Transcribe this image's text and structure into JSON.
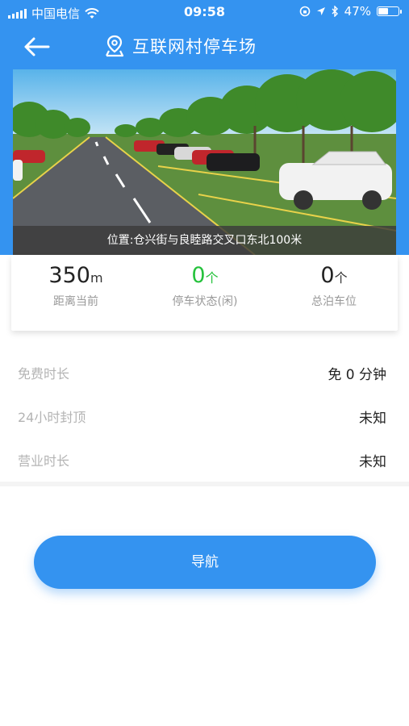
{
  "status_bar": {
    "carrier": "中国电信",
    "time": "09:58",
    "battery": "47%",
    "battery_level": 0.47
  },
  "header": {
    "title": "互联网村停车场"
  },
  "hero": {
    "location_caption": "位置:仓兴街与良睦路交叉口东北100米"
  },
  "stats": [
    {
      "value": "350",
      "unit": "m",
      "label": "距离当前"
    },
    {
      "value": "0",
      "unit": "个",
      "label": "停车状态(闲)"
    },
    {
      "value": "0",
      "unit": "个",
      "label": "总泊车位"
    }
  ],
  "info": [
    {
      "key": "免费时长",
      "value": "免 0 分钟"
    },
    {
      "key": "24小时封顶",
      "value": "未知"
    },
    {
      "key": "营业时长",
      "value": "未知"
    }
  ],
  "actions": {
    "navigate_label": "导航"
  },
  "colors": {
    "brand": "#3493f0",
    "status_free": "#25c23c"
  }
}
